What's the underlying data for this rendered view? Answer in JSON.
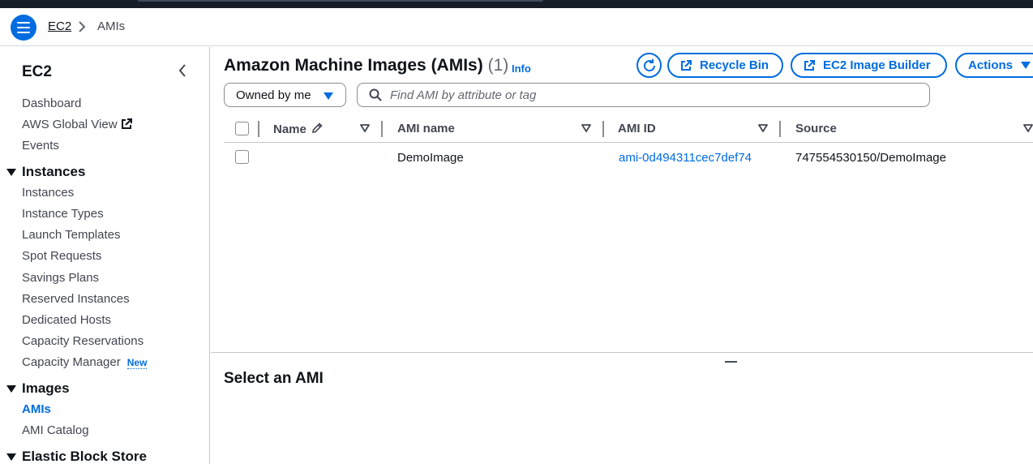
{
  "breadcrumb": {
    "parent": "EC2",
    "current": "AMIs"
  },
  "sidebar": {
    "title": "EC2",
    "top_items": [
      "Dashboard",
      "AWS Global View",
      "Events"
    ],
    "sections": [
      {
        "title": "Instances",
        "items": [
          "Instances",
          "Instance Types",
          "Launch Templates",
          "Spot Requests",
          "Savings Plans",
          "Reserved Instances",
          "Dedicated Hosts",
          "Capacity Reservations",
          "Capacity Manager"
        ]
      },
      {
        "title": "Images",
        "items": [
          "AMIs",
          "AMI Catalog"
        ]
      },
      {
        "title": "Elastic Block Store",
        "items": []
      }
    ],
    "new_badge": "New",
    "active_item": "AMIs"
  },
  "header": {
    "title": "Amazon Machine Images (AMIs)",
    "count": "(1)",
    "info": "Info"
  },
  "toolbar": {
    "recycle_bin": "Recycle Bin",
    "image_builder": "EC2 Image Builder",
    "actions": "Actions"
  },
  "filter": {
    "owner": "Owned by me",
    "search_placeholder": "Find AMI by attribute or tag",
    "search_value": ""
  },
  "table": {
    "columns": [
      "Name",
      "AMI name",
      "AMI ID",
      "Source"
    ],
    "rows": [
      {
        "name": "",
        "ami_name": "DemoImage",
        "ami_id": "ami-0d494311cec7def74",
        "source": "747554530150/DemoImage"
      }
    ]
  },
  "details": {
    "title": "Select an AMI"
  },
  "colors": {
    "accent": "#006ce0",
    "text": "#0f141a",
    "muted": "#424650",
    "border": "#c6c6cd",
    "topbar": "#161d26"
  }
}
